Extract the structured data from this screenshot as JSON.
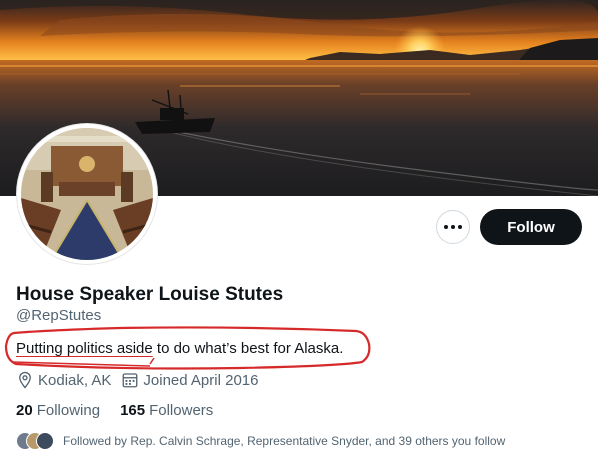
{
  "profile": {
    "display_name": "House Speaker Louise Stutes",
    "handle": "@RepStutes",
    "bio_part1": "Putting politics aside",
    "bio_part2": " to do what’s best for Alaska.",
    "location": "Kodiak, AK",
    "joined": "Joined April 2016",
    "following_count": "20",
    "following_label": "Following",
    "followers_count": "165",
    "followers_label": "Followers",
    "followed_by": "Followed by Rep. Calvin Schrage, Representative Snyder, and 39 others you follow"
  },
  "actions": {
    "follow_label": "Follow",
    "more_icon": "ellipsis-icon"
  },
  "icons": {
    "location": "location-pin-icon",
    "calendar": "calendar-icon"
  },
  "colors": {
    "follow_bg": "#0f1419",
    "secondary_text": "#536471",
    "annotation_red": "#d62a2a"
  }
}
